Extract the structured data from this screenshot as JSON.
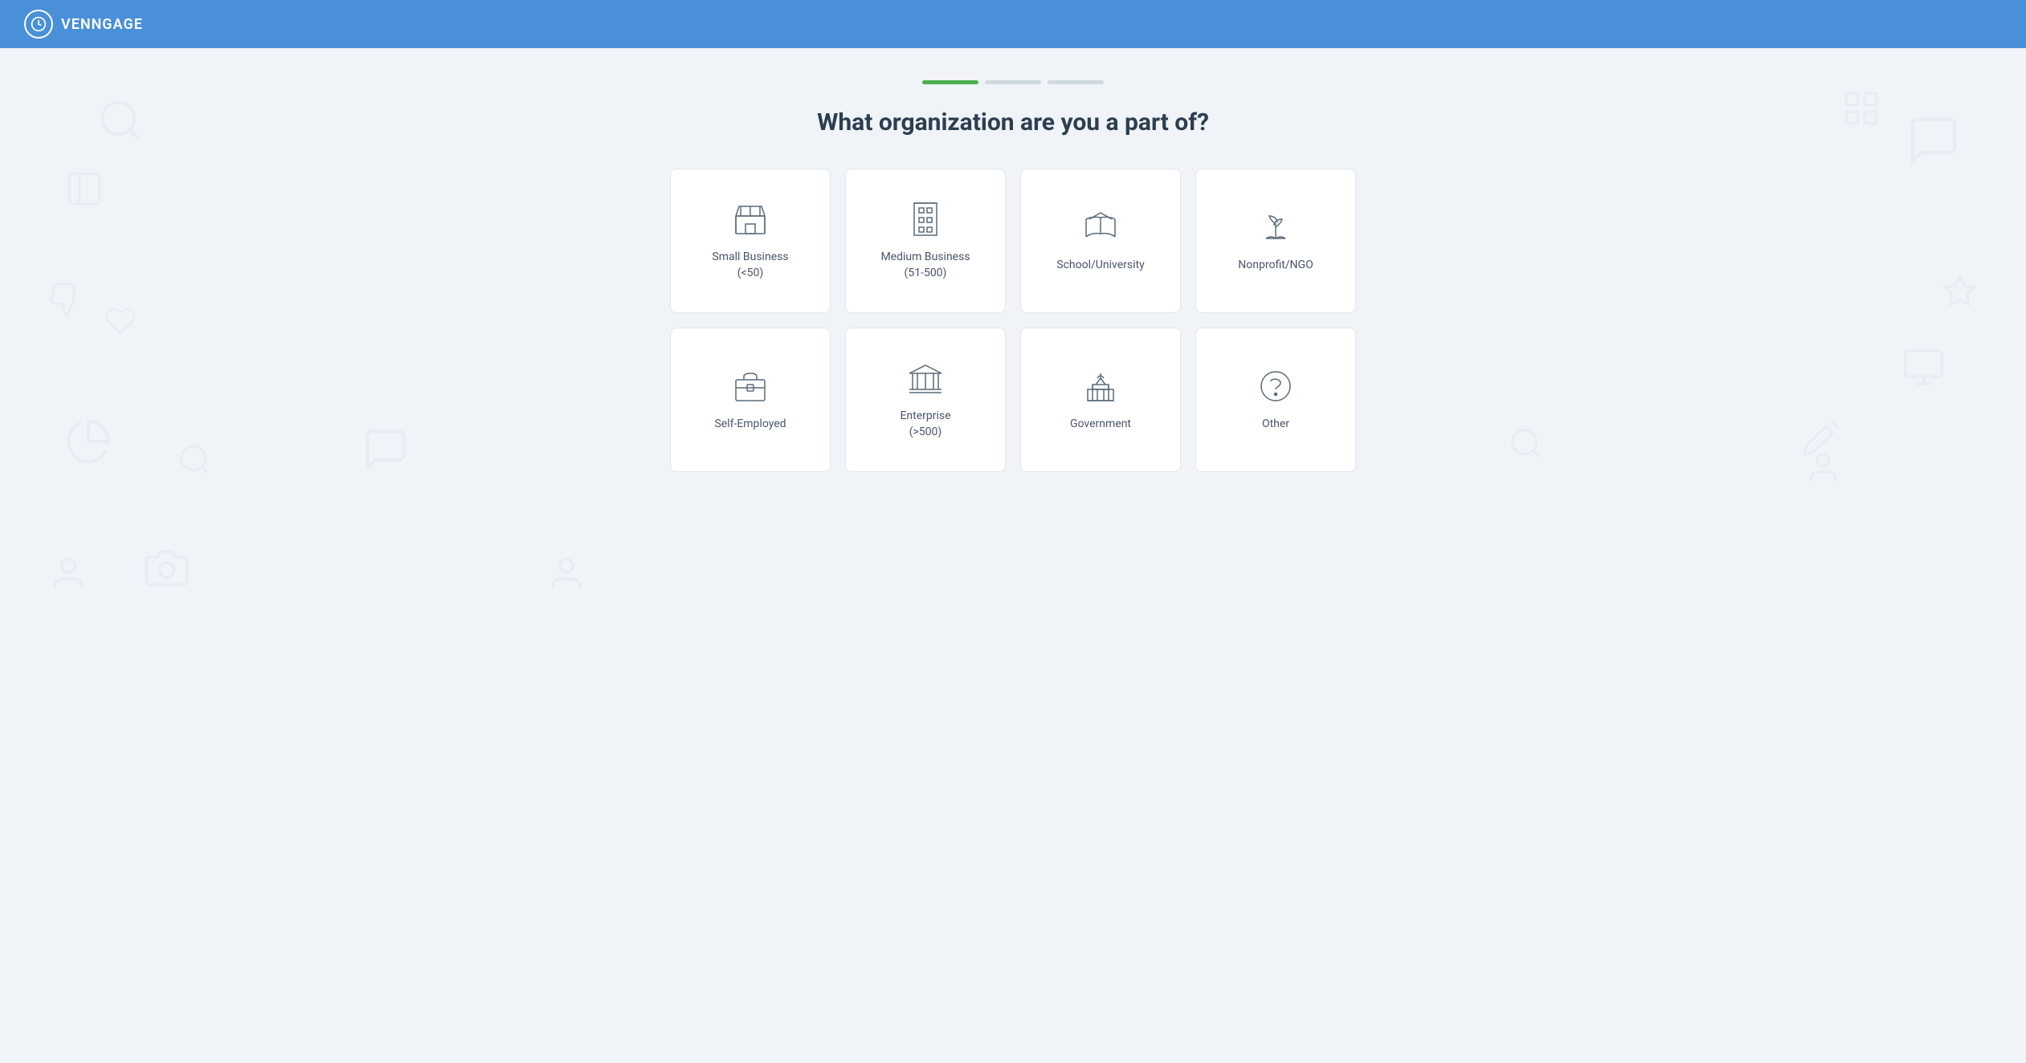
{
  "header": {
    "logo_text": "VENNGAGE"
  },
  "progress": {
    "segments": [
      {
        "state": "active"
      },
      {
        "state": "inactive"
      },
      {
        "state": "inactive"
      }
    ]
  },
  "page": {
    "title": "What organization are you a part of?"
  },
  "cards": [
    {
      "id": "small-business",
      "label": "Small Business\n(<50)",
      "label_line1": "Small Business",
      "label_line2": "(<50)",
      "icon": "store"
    },
    {
      "id": "medium-business",
      "label": "Medium Business\n(51-500)",
      "label_line1": "Medium Business",
      "label_line2": "(51-500)",
      "icon": "office-building"
    },
    {
      "id": "school-university",
      "label": "School/University",
      "label_line1": "School/University",
      "label_line2": "",
      "icon": "school"
    },
    {
      "id": "nonprofit-ngo",
      "label": "Nonprofit/NGO",
      "label_line1": "Nonprofit/NGO",
      "label_line2": "",
      "icon": "nonprofit"
    },
    {
      "id": "self-employed",
      "label": "Self-Employed",
      "label_line1": "Self-Employed",
      "label_line2": "",
      "icon": "briefcase"
    },
    {
      "id": "enterprise",
      "label": "Enterprise\n(>500)",
      "label_line1": "Enterprise",
      "label_line2": "(>500)",
      "icon": "enterprise"
    },
    {
      "id": "government",
      "label": "Government",
      "label_line1": "Government",
      "label_line2": "",
      "icon": "government"
    },
    {
      "id": "other",
      "label": "Other",
      "label_line1": "Other",
      "label_line2": "",
      "icon": "question"
    }
  ]
}
